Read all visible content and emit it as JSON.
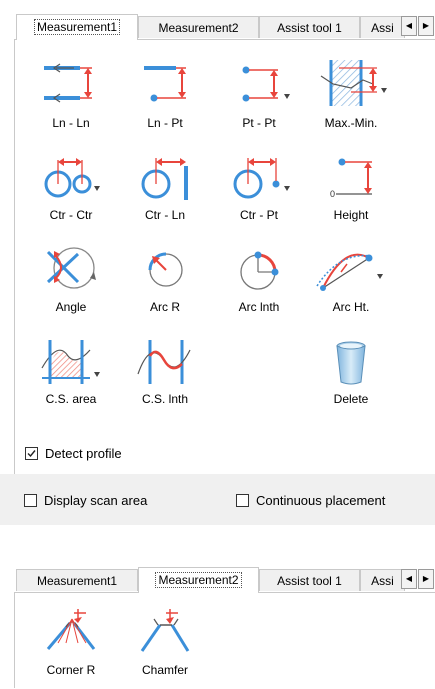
{
  "panel1": {
    "tabs": [
      {
        "label": "Measurement1",
        "active": true
      },
      {
        "label": "Measurement2",
        "active": false
      },
      {
        "label": "Assist tool 1",
        "active": false
      },
      {
        "label": "Assi",
        "active": false
      }
    ],
    "tools": [
      {
        "label": "Ln - Ln",
        "icon": "line-to-line-icon"
      },
      {
        "label": "Ln - Pt",
        "icon": "line-to-point-icon"
      },
      {
        "label": "Pt - Pt",
        "icon": "point-to-point-icon"
      },
      {
        "label": "Max.-Min.",
        "icon": "max-min-icon"
      },
      {
        "label": "Ctr - Ctr",
        "icon": "center-to-center-icon"
      },
      {
        "label": "Ctr - Ln",
        "icon": "center-to-line-icon"
      },
      {
        "label": "Ctr - Pt",
        "icon": "center-to-point-icon"
      },
      {
        "label": "Height",
        "icon": "height-icon"
      },
      {
        "label": "Angle",
        "icon": "angle-icon"
      },
      {
        "label": "Arc R",
        "icon": "arc-radius-icon"
      },
      {
        "label": "Arc lnth",
        "icon": "arc-length-icon"
      },
      {
        "label": "Arc Ht.",
        "icon": "arc-height-icon"
      },
      {
        "label": "C.S. area",
        "icon": "cross-section-area-icon"
      },
      {
        "label": "C.S. lnth",
        "icon": "cross-section-length-icon"
      },
      {
        "label": "Delete",
        "icon": "trash-icon"
      }
    ],
    "detect_profile": {
      "label": "Detect profile",
      "checked": true
    },
    "display_scan_area": {
      "label": "Display scan area",
      "checked": false
    },
    "continuous_placement": {
      "label": "Continuous placement",
      "checked": false
    }
  },
  "panel2": {
    "tabs": [
      {
        "label": "Measurement1",
        "active": false
      },
      {
        "label": "Measurement2",
        "active": true
      },
      {
        "label": "Assist tool 1",
        "active": false
      },
      {
        "label": "Assi",
        "active": false
      }
    ],
    "tools": [
      {
        "label": "Corner R",
        "icon": "corner-radius-icon"
      },
      {
        "label": "Chamfer",
        "icon": "chamfer-icon"
      }
    ]
  },
  "colors": {
    "accent_blue": "#3b8fd9",
    "measure_red": "#e8453c",
    "hatch_red": "#f08a80"
  }
}
